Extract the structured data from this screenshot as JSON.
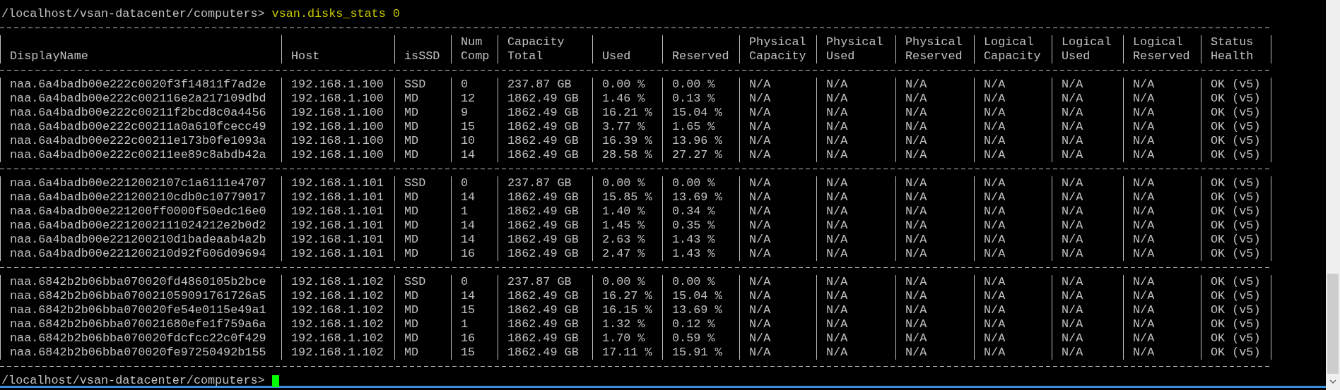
{
  "terminal": {
    "command_line": {
      "prompt": "/localhost/vsan-datacenter/computers>",
      "command": "vsan.disks_stats 0"
    },
    "table": {
      "columns": [
        "DisplayName",
        "Host",
        "isSSD",
        "Num Comp",
        "Capacity Total",
        "Used",
        "Reserved",
        "Physical Capacity",
        "Physical Used",
        "Physical Reserved",
        "Logical Capacity",
        "Logical Used",
        "Logical Reserved",
        "Status Health"
      ],
      "groups": [
        {
          "rows": [
            [
              "naa.6a4badb00e222c0020f3f14811f7ad2e",
              "192.168.1.100",
              "SSD",
              "0",
              "237.87 GB",
              "0.00 %",
              "0.00 %",
              "N/A",
              "N/A",
              "N/A",
              "N/A",
              "N/A",
              "N/A",
              "OK (v5)"
            ],
            [
              "naa.6a4badb00e222c002116e2a217109dbd",
              "192.168.1.100",
              "MD",
              "12",
              "1862.49 GB",
              "1.46 %",
              "0.13 %",
              "N/A",
              "N/A",
              "N/A",
              "N/A",
              "N/A",
              "N/A",
              "OK (v5)"
            ],
            [
              "naa.6a4badb00e222c00211f2bcd8c0a4456",
              "192.168.1.100",
              "MD",
              "9",
              "1862.49 GB",
              "16.21 %",
              "15.04 %",
              "N/A",
              "N/A",
              "N/A",
              "N/A",
              "N/A",
              "N/A",
              "OK (v5)"
            ],
            [
              "naa.6a4badb00e222c00211a0a610fcecc49",
              "192.168.1.100",
              "MD",
              "15",
              "1862.49 GB",
              "3.77 %",
              "1.65 %",
              "N/A",
              "N/A",
              "N/A",
              "N/A",
              "N/A",
              "N/A",
              "OK (v5)"
            ],
            [
              "naa.6a4badb00e222c00211e173b0fe1093a",
              "192.168.1.100",
              "MD",
              "10",
              "1862.49 GB",
              "16.39 %",
              "13.96 %",
              "N/A",
              "N/A",
              "N/A",
              "N/A",
              "N/A",
              "N/A",
              "OK (v5)"
            ],
            [
              "naa.6a4badb00e222c00211ee89c8abdb42a",
              "192.168.1.100",
              "MD",
              "14",
              "1862.49 GB",
              "28.58 %",
              "27.27 %",
              "N/A",
              "N/A",
              "N/A",
              "N/A",
              "N/A",
              "N/A",
              "OK (v5)"
            ]
          ]
        },
        {
          "rows": [
            [
              "naa.6a4badb00e2212002107c1a6111e4707",
              "192.168.1.101",
              "SSD",
              "0",
              "237.87 GB",
              "0.00 %",
              "0.00 %",
              "N/A",
              "N/A",
              "N/A",
              "N/A",
              "N/A",
              "N/A",
              "OK (v5)"
            ],
            [
              "naa.6a4badb00e221200210cdb0c10779017",
              "192.168.1.101",
              "MD",
              "14",
              "1862.49 GB",
              "15.85 %",
              "13.69 %",
              "N/A",
              "N/A",
              "N/A",
              "N/A",
              "N/A",
              "N/A",
              "OK (v5)"
            ],
            [
              "naa.6a4badb00e221200ff0000f50edc16e0",
              "192.168.1.101",
              "MD",
              "1",
              "1862.49 GB",
              "1.40 %",
              "0.34 %",
              "N/A",
              "N/A",
              "N/A",
              "N/A",
              "N/A",
              "N/A",
              "OK (v5)"
            ],
            [
              "naa.6a4badb00e2212002111024212e2b0d2",
              "192.168.1.101",
              "MD",
              "14",
              "1862.49 GB",
              "1.45 %",
              "0.35 %",
              "N/A",
              "N/A",
              "N/A",
              "N/A",
              "N/A",
              "N/A",
              "OK (v5)"
            ],
            [
              "naa.6a4badb00e221200210d1badeaab4a2b",
              "192.168.1.101",
              "MD",
              "14",
              "1862.49 GB",
              "2.63 %",
              "1.43 %",
              "N/A",
              "N/A",
              "N/A",
              "N/A",
              "N/A",
              "N/A",
              "OK (v5)"
            ],
            [
              "naa.6a4badb00e221200210d92f606d09694",
              "192.168.1.101",
              "MD",
              "16",
              "1862.49 GB",
              "2.47 %",
              "1.43 %",
              "N/A",
              "N/A",
              "N/A",
              "N/A",
              "N/A",
              "N/A",
              "OK (v5)"
            ]
          ]
        },
        {
          "rows": [
            [
              "naa.6842b2b06bba070020fd4860105b2bce",
              "192.168.1.102",
              "SSD",
              "0",
              "237.87 GB",
              "0.00 %",
              "0.00 %",
              "N/A",
              "N/A",
              "N/A",
              "N/A",
              "N/A",
              "N/A",
              "OK (v5)"
            ],
            [
              "naa.6842b2b06bba070021059091761726a5",
              "192.168.1.102",
              "MD",
              "14",
              "1862.49 GB",
              "16.27 %",
              "15.04 %",
              "N/A",
              "N/A",
              "N/A",
              "N/A",
              "N/A",
              "N/A",
              "OK (v5)"
            ],
            [
              "naa.6842b2b06bba070020fe54e0115e49a1",
              "192.168.1.102",
              "MD",
              "15",
              "1862.49 GB",
              "16.15 %",
              "13.69 %",
              "N/A",
              "N/A",
              "N/A",
              "N/A",
              "N/A",
              "N/A",
              "OK (v5)"
            ],
            [
              "naa.6842b2b06bba070021680efe1f759a6a",
              "192.168.1.102",
              "MD",
              "1",
              "1862.49 GB",
              "1.32 %",
              "0.12 %",
              "N/A",
              "N/A",
              "N/A",
              "N/A",
              "N/A",
              "N/A",
              "OK (v5)"
            ],
            [
              "naa.6842b2b06bba070020fdcfcc22c0f429",
              "192.168.1.102",
              "MD",
              "16",
              "1862.49 GB",
              "1.70 %",
              "0.59 %",
              "N/A",
              "N/A",
              "N/A",
              "N/A",
              "N/A",
              "N/A",
              "OK (v5)"
            ],
            [
              "naa.6842b2b06bba070020fe97250492b155",
              "192.168.1.102",
              "MD",
              "15",
              "1862.49 GB",
              "17.11 %",
              "15.91 %",
              "N/A",
              "N/A",
              "N/A",
              "N/A",
              "N/A",
              "N/A",
              "OK (v5)"
            ]
          ]
        }
      ]
    },
    "prompt_line": {
      "prompt": "/localhost/vsan-datacenter/computers>"
    }
  }
}
